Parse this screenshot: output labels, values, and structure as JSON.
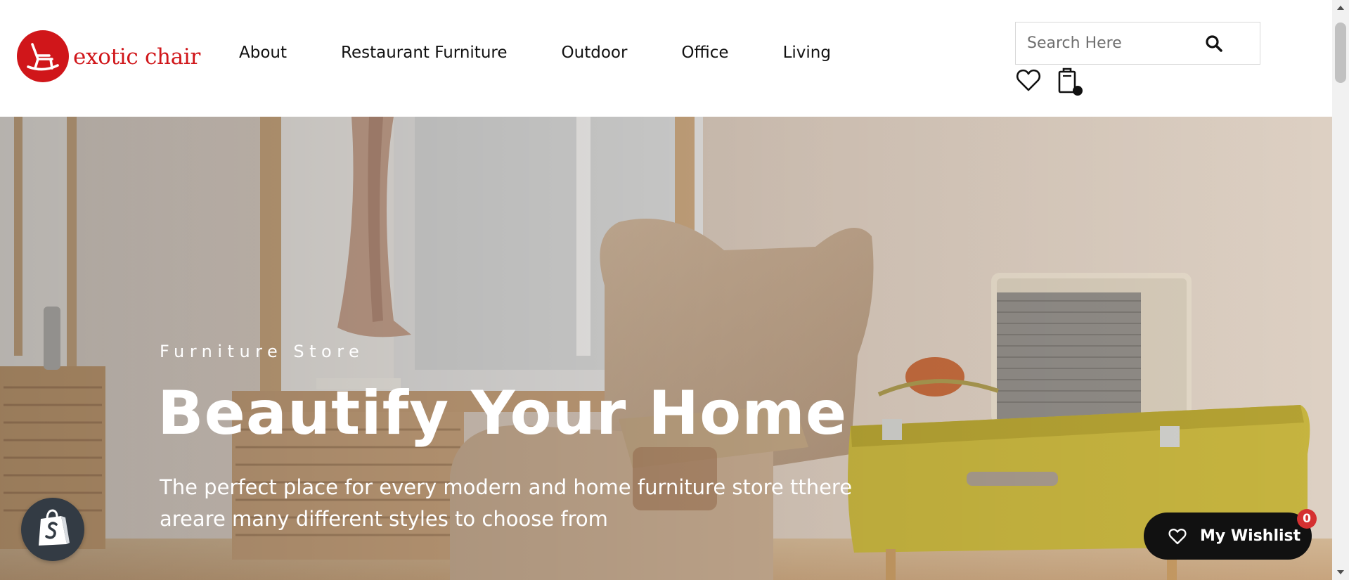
{
  "brand": {
    "name": "exotic chair",
    "color": "#d0161a"
  },
  "nav": {
    "items": [
      {
        "label": "About"
      },
      {
        "label": "Restaurant Furniture"
      },
      {
        "label": "Outdoor"
      },
      {
        "label": "Office"
      },
      {
        "label": "Living"
      }
    ]
  },
  "search": {
    "placeholder": "Search Here",
    "value": "",
    "icon": "search-icon"
  },
  "header_icons": {
    "wishlist": "heart-icon",
    "cart": "shopping-bag-icon"
  },
  "hero": {
    "eyebrow": "Furniture Store",
    "title": "Beautify Your Home",
    "subtitle": "The perfect place for every modern and home furniture store tthere areare many different styles to choose from"
  },
  "wishlist_button": {
    "label": "My Wishlist",
    "count": "0",
    "icon": "heart-icon",
    "badge_color": "#d53031"
  },
  "shopify_badge": {
    "icon": "shopify-bag-icon"
  }
}
